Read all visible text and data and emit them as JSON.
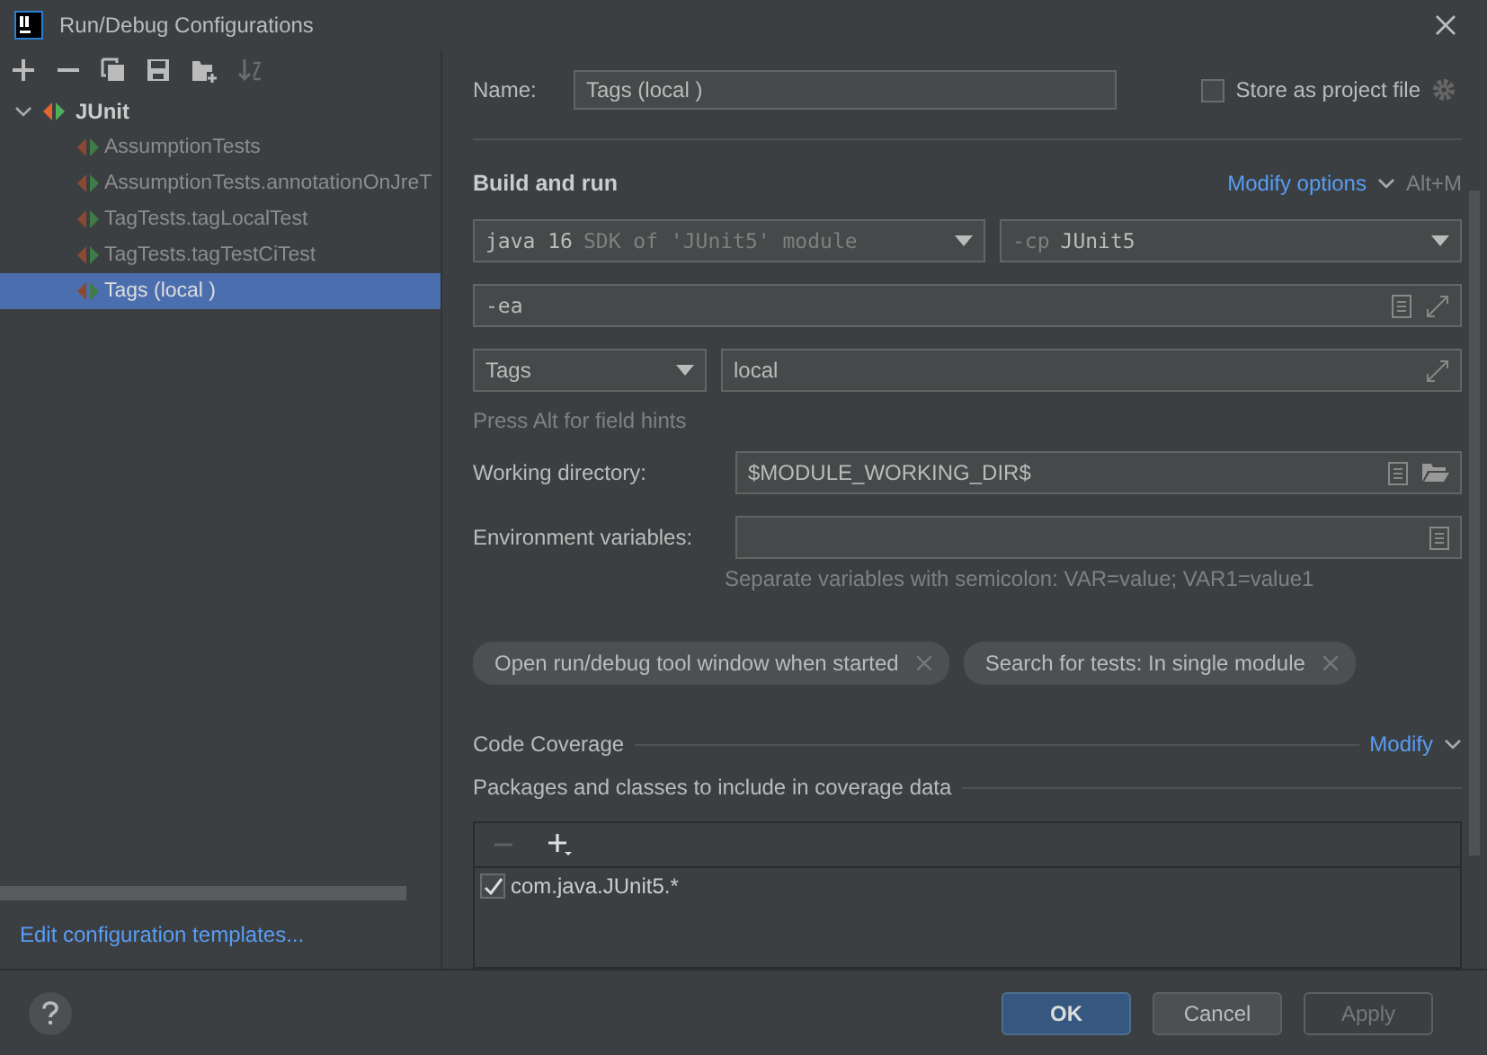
{
  "window": {
    "title": "Run/Debug Configurations"
  },
  "tree": [
    {
      "label": "JUnit",
      "expanded": true,
      "selected": false,
      "children": [
        {
          "label": "AssumptionTests",
          "selected": false
        },
        {
          "label": "AssumptionTests.annotationOnJreT",
          "selected": false
        },
        {
          "label": "TagTests.tagLocalTest",
          "selected": false
        },
        {
          "label": "TagTests.tagTestCiTest",
          "selected": false
        },
        {
          "label": "Tags (local )",
          "selected": true
        }
      ]
    }
  ],
  "templates_link": "Edit configuration templates...",
  "name": {
    "label": "Name:",
    "value": "Tags (local )"
  },
  "store_as_project_file": {
    "label": "Store as project file",
    "checked": false
  },
  "build_and_run": {
    "title": "Build and run",
    "modify_options": "Modify options",
    "shortcut": "Alt+M",
    "jre": {
      "main": "java 16",
      "detail": "SDK of 'JUnit5' module"
    },
    "classpath": {
      "prefix": "-cp",
      "value": "JUnit5"
    },
    "vm_options": "-ea",
    "test_kind": "Tags",
    "test_value": "local",
    "hint": "Press Alt for field hints"
  },
  "working_directory": {
    "label": "Working directory:",
    "value": "$MODULE_WORKING_DIR$"
  },
  "environment_variables": {
    "label": "Environment variables:",
    "hint": "Separate variables with semicolon: VAR=value; VAR1=value1"
  },
  "chips": [
    "Open run/debug tool window when started",
    "Search for tests: In single module"
  ],
  "code_coverage": {
    "title": "Code Coverage",
    "modify": "Modify",
    "packages_title": "Packages and classes to include in coverage data",
    "patterns": [
      {
        "label": "com.java.JUnit5.*",
        "checked": true
      }
    ]
  },
  "buttons": [
    {
      "label": "OK",
      "kind": "primary",
      "disabled": false
    },
    {
      "label": "Cancel",
      "kind": "normal",
      "disabled": false
    },
    {
      "label": "Apply",
      "kind": "normal",
      "disabled": true
    }
  ]
}
